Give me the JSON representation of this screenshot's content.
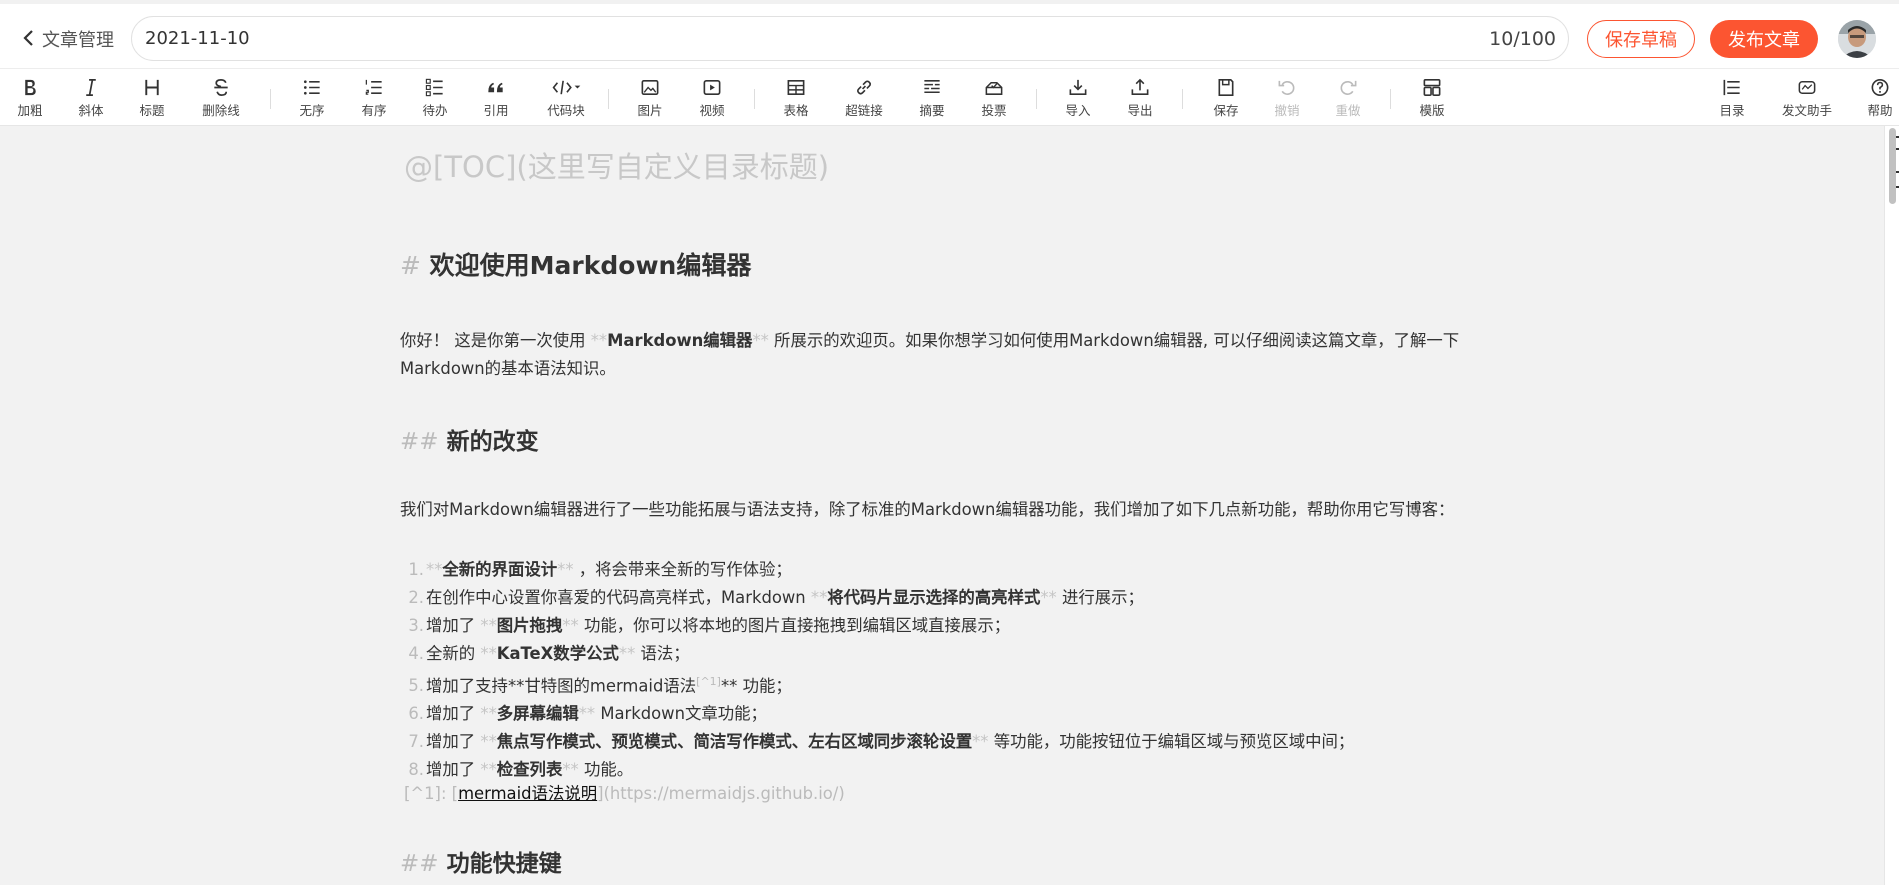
{
  "header": {
    "back_label": "文章管理",
    "title_value": "2021-11-10",
    "title_count": "10/100",
    "save_draft_label": "保存草稿",
    "publish_label": "发布文章"
  },
  "toolbar": {
    "items": [
      {
        "icon": "bold-icon",
        "label": "加粗"
      },
      {
        "icon": "italic-icon",
        "label": "斜体"
      },
      {
        "icon": "heading-icon",
        "label": "标题"
      },
      {
        "icon": "strikethrough-icon",
        "label": "删除线"
      },
      {
        "icon": "unordered-list-icon",
        "label": "无序"
      },
      {
        "icon": "ordered-list-icon",
        "label": "有序"
      },
      {
        "icon": "todo-list-icon",
        "label": "待办"
      },
      {
        "icon": "quote-icon",
        "label": "引用"
      },
      {
        "icon": "code-block-icon",
        "label": "代码块"
      },
      {
        "icon": "image-icon",
        "label": "图片"
      },
      {
        "icon": "video-icon",
        "label": "视频"
      },
      {
        "icon": "table-icon",
        "label": "表格"
      },
      {
        "icon": "link-icon",
        "label": "超链接"
      },
      {
        "icon": "summary-icon",
        "label": "摘要"
      },
      {
        "icon": "vote-icon",
        "label": "投票"
      },
      {
        "icon": "import-icon",
        "label": "导入"
      },
      {
        "icon": "export-icon",
        "label": "导出"
      },
      {
        "icon": "save-icon",
        "label": "保存"
      },
      {
        "icon": "undo-icon",
        "label": "撤销"
      },
      {
        "icon": "redo-icon",
        "label": "重做"
      },
      {
        "icon": "template-icon",
        "label": "模版"
      },
      {
        "icon": "toc-icon",
        "label": "目录"
      },
      {
        "icon": "assistant-icon",
        "label": "发文助手"
      },
      {
        "icon": "help-icon",
        "label": "帮助"
      }
    ]
  },
  "editor": {
    "toc": "@[TOC](这里写自定义目录标题)",
    "h1_mark": "#",
    "h1_text": "欢迎使用Markdown编辑器",
    "intro_pre": "你好！ 这是你第一次使用 ",
    "intro_bold": "Markdown编辑器",
    "intro_post": " 所展示的欢迎页。如果你想学习如何使用Markdown编辑器, 可以仔细阅读这篇文章，了解一下Markdown的基本语法知识。",
    "h2a_mark": "##",
    "h2a_text": "新的改变",
    "para2": "我们对Markdown编辑器进行了一些功能拓展与语法支持，除了标准的Markdown编辑器功能，我们增加了如下几点新功能，帮助你用它写博客：",
    "list": [
      {
        "num": "1.",
        "pre": "",
        "bold": "全新的界面设计",
        "post": " ，将会带来全新的写作体验；"
      },
      {
        "num": "2.",
        "pre": "在创作中心设置你喜爱的代码高亮样式，Markdown ",
        "bold": "将代码片显示选择的高亮样式",
        "post": " 进行展示；"
      },
      {
        "num": "3.",
        "pre": "增加了 ",
        "bold": "图片拖拽",
        "post": " 功能，你可以将本地的图片直接拖拽到编辑区域直接展示；"
      },
      {
        "num": "4.",
        "pre": "全新的 ",
        "bold": "KaTeX数学公式",
        "post": " 语法；"
      },
      {
        "num": "5.",
        "pre": "增加了支持**甘特图的mermaid语法",
        "sup": "[^1]",
        "post": "** 功能；"
      },
      {
        "num": "6.",
        "pre": "增加了 ",
        "bold": "多屏幕编辑",
        "post": " Markdown文章功能；"
      },
      {
        "num": "7.",
        "pre": "增加了 ",
        "bold": "焦点写作模式、预览模式、简洁写作模式、左右区域同步滚轮设置",
        "post": " 等功能，功能按钮位于编辑区域与预览区域中间；"
      },
      {
        "num": "8.",
        "pre": "增加了 ",
        "bold": "检查列表",
        "post": " 功能。"
      }
    ],
    "footnote_ref": "[^1]: [",
    "footnote_link": "mermaid语法说明",
    "footnote_url": "](https://mermaidjs.github.io/)",
    "h2b_mark": "##",
    "h2b_text": "功能快捷键"
  },
  "colors": {
    "accent": "#fc5531",
    "syntax_mark": "#bbbbbb"
  }
}
